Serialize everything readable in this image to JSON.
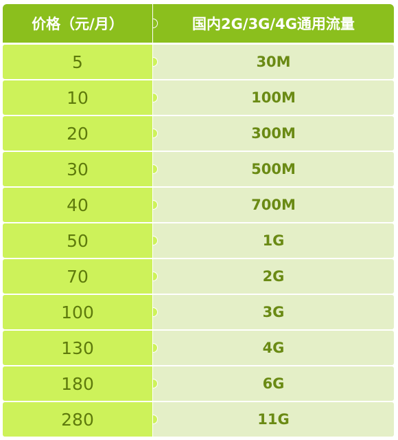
{
  "header": {
    "price_label": "价格（元/月）",
    "data_label": "国内2G/3G/4G通用流量"
  },
  "rows": [
    {
      "price": "5",
      "data": "30M"
    },
    {
      "price": "10",
      "data": "100M"
    },
    {
      "price": "20",
      "data": "300M"
    },
    {
      "price": "30",
      "data": "500M"
    },
    {
      "price": "40",
      "data": "700M"
    },
    {
      "price": "50",
      "data": "1G"
    },
    {
      "price": "70",
      "data": "2G"
    },
    {
      "price": "100",
      "data": "3G"
    },
    {
      "price": "130",
      "data": "4G"
    },
    {
      "price": "180",
      "data": "6G"
    },
    {
      "price": "280",
      "data": "11G"
    }
  ],
  "colors": {
    "header_bg": "#8bbf1d",
    "price_cell_bg": "#cdf25a",
    "data_cell_bg": "#e4efc7",
    "text_green": "#6a8a14"
  }
}
